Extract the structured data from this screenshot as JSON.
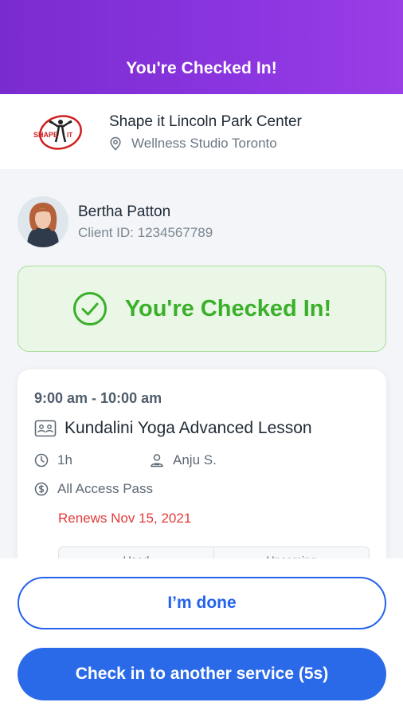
{
  "header": {
    "title": "You're Checked In!"
  },
  "studio": {
    "logo_icon": "shape-it-logo",
    "name": "Shape it Lincoln Park Center",
    "location": "Wellness Studio Toronto",
    "location_icon": "map-pin-icon"
  },
  "client": {
    "name": "Bertha Patton",
    "client_id": "Client ID: 1234567789"
  },
  "status": {
    "message": "You're Checked In!",
    "icon": "check-circle-icon",
    "color": "#3ab02a"
  },
  "booking": {
    "time": "9:00 am - 10:00 am",
    "lesson": "Kundalini Yoga Advanced Lesson",
    "duration": "1h",
    "instructor": "Anju S.",
    "pass": "All Access Pass",
    "renews": "Renews Nov 15, 2021",
    "tabs": [
      "Used",
      "Upcoming"
    ]
  },
  "actions": {
    "done_label": "I’m done",
    "another_label": "Check in to another service (5s)",
    "accent": "#2563eb"
  }
}
